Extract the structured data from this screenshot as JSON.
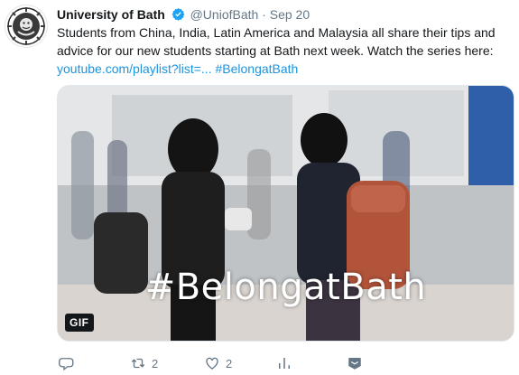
{
  "tweet": {
    "display_name": "University of Bath",
    "handle": "@UniofBath",
    "separator": "·",
    "timestamp": "Sep 20",
    "text_main": "Students from China, India, Latin America and Malaysia all share their tips and advice for our new students starting at Bath next week. Watch the series here:",
    "link_url": "youtube.com/playlist?list=...",
    "hashtag": "#BelongatBath",
    "media_overlay_text": "#BelongatBath",
    "gif_badge": "GIF",
    "retweets": "2",
    "likes": "2"
  },
  "colors": {
    "link": "#1b95e0",
    "verified": "#1da1f2",
    "muted": "#657786"
  },
  "icons": [
    "university-crest-icon",
    "verified-badge-icon",
    "reply-icon",
    "retweet-icon",
    "like-icon",
    "analytics-icon",
    "dm-icon"
  ]
}
